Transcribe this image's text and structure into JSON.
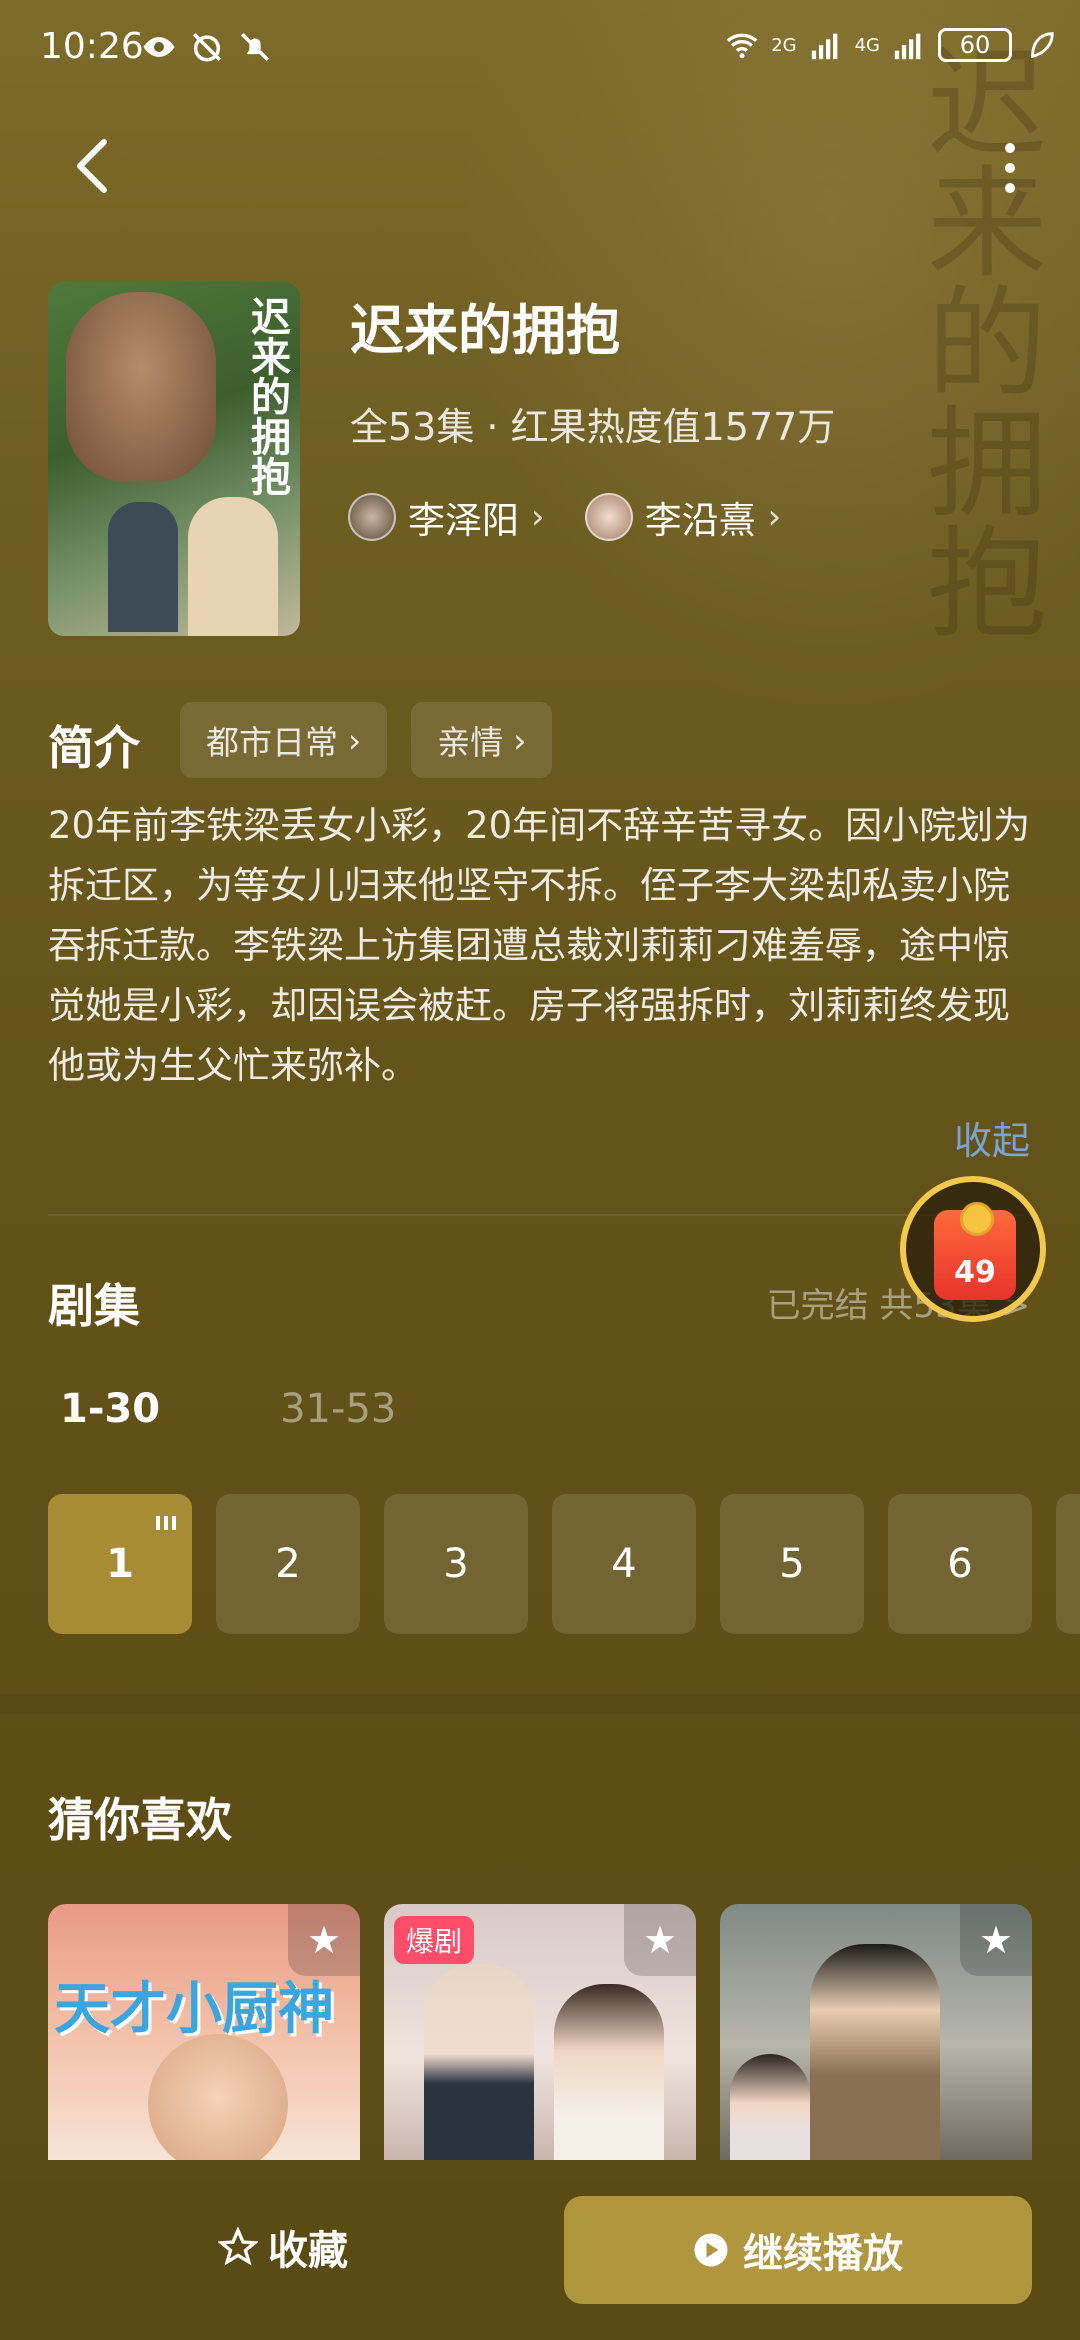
{
  "status_bar": {
    "time": "10:26",
    "network_left": "2G",
    "network_right": "4G",
    "battery": "60"
  },
  "drama": {
    "title": "迟来的拥抱",
    "meta": "全53集 · 红果热度值1577万",
    "poster_calligraphy": "迟来的拥抱",
    "actors": [
      {
        "name": "李泽阳"
      },
      {
        "name": "李沿熹"
      }
    ]
  },
  "intro": {
    "heading": "简介",
    "tags": [
      "都市日常",
      "亲情"
    ],
    "description": "20年前李铁梁丢女小彩，20年间不辞辛苦寻女。因小院划为拆迁区，为等女儿归来他坚守不拆。侄子李大梁却私卖小院吞拆迁款。李铁梁上访集团遭总裁刘莉莉刁难羞辱，途中惊觉她是小彩，却因误会被赶。房子将强拆时，刘莉莉终发现他或为生父忙来弥补。",
    "collapse_label": "收起"
  },
  "episodes": {
    "heading": "剧集",
    "status": "已完结 共53集 >",
    "ranges": [
      "1-30",
      "31-53"
    ],
    "active_range": 0,
    "items": [
      "1",
      "2",
      "3",
      "4",
      "5",
      "6"
    ],
    "current": "1"
  },
  "red_packet": {
    "count": "49"
  },
  "recommend": {
    "heading": "猜你喜欢",
    "cards": [
      {
        "cover_text": "天才小厨神",
        "badge": ""
      },
      {
        "cover_text": "",
        "badge": "爆剧"
      },
      {
        "cover_text": "",
        "badge": ""
      }
    ]
  },
  "bottom_bar": {
    "favorite_label": "收藏",
    "play_label": "继续播放"
  },
  "colors": {
    "accent": "#b0963f",
    "link": "#7aa3d6",
    "badge": "#ff4d6a"
  }
}
